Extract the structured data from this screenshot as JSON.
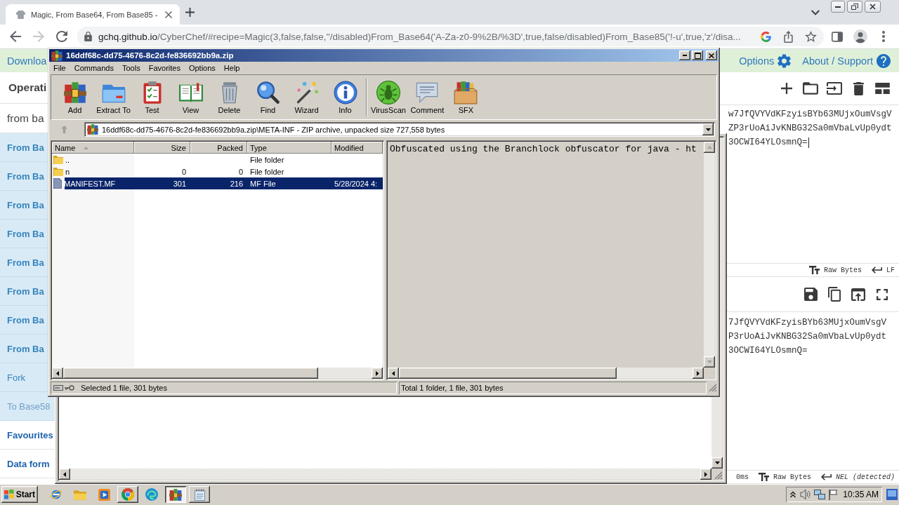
{
  "browser": {
    "tab": {
      "title": "Magic, From Base64, From Base85 -",
      "selected": true
    },
    "nav": [
      {
        "kind": "back",
        "disabled": false
      },
      {
        "kind": "forward",
        "disabled": true
      },
      {
        "kind": "reload",
        "disabled": false
      }
    ],
    "address": {
      "host": "gchq.github.io",
      "path": "/CyberChef/#recipe=Magic(3,false,false,''/disabled)From_Base64('A-Za-z0-9%2B/%3D',true,false/disabled)From_Base85('!-u',true,'z'/disa..."
    }
  },
  "cyberchef": {
    "banner": {
      "download": "Downloa",
      "options": "Options",
      "about": "About / Support"
    },
    "operations": {
      "title": "Operati",
      "search": "from ba",
      "items": [
        {
          "label": "From Ba",
          "kind": "match"
        },
        {
          "label": "From Ba",
          "kind": "match"
        },
        {
          "label": "From Ba",
          "kind": "match"
        },
        {
          "label": "From Ba",
          "kind": "match"
        },
        {
          "label": "From Ba",
          "kind": "match"
        },
        {
          "label": "From Ba",
          "kind": "match"
        },
        {
          "label": "From Ba",
          "kind": "match"
        },
        {
          "label": "From Ba",
          "kind": "match"
        },
        {
          "label": "Fork",
          "kind": "plain"
        },
        {
          "label": "To Base58",
          "kind": "faded"
        },
        {
          "label": "Favourites",
          "kind": "category"
        },
        {
          "label": "Data form",
          "kind": "category"
        }
      ]
    },
    "input": {
      "lines": [
        "w7JfQVYVdKFzyisBYb63MUjxOumVsgV",
        "ZP3rUoAiJvKNBG32Sa0mVbaLvUp0ydt",
        "3OCWI64YLOsmnQ="
      ],
      "format": "Raw Bytes",
      "eol": "LF"
    },
    "output": {
      "lines": [
        "7JfQVYVdKFzyisBYb63MUjxOumVsgV",
        "P3rUoAiJvKNBG32Sa0mVbaLvUp0ydt",
        "3OCWI64YLOsmnQ="
      ],
      "time": "0ms",
      "format": "Raw Bytes",
      "eol": "NEL (detected)"
    }
  },
  "winrar": {
    "title": "16ddf68c-dd75-4676-8c2d-fe836692bb9a.zip",
    "menu": [
      "File",
      "Commands",
      "Tools",
      "Favorites",
      "Options",
      "Help"
    ],
    "toolbar": [
      {
        "buttons": [
          {
            "label": "Add",
            "kind": "add"
          },
          {
            "label": "Extract To",
            "kind": "extract"
          },
          {
            "label": "Test",
            "kind": "test"
          },
          {
            "label": "View",
            "kind": "view"
          },
          {
            "label": "Delete",
            "kind": "delete"
          },
          {
            "label": "Find",
            "kind": "find"
          },
          {
            "label": "Wizard",
            "kind": "wizard"
          },
          {
            "label": "Info",
            "kind": "info"
          }
        ]
      },
      {
        "buttons": [
          {
            "label": "VirusScan",
            "kind": "virusscan"
          },
          {
            "label": "Comment",
            "kind": "comment"
          },
          {
            "label": "SFX",
            "kind": "sfx"
          }
        ]
      }
    ],
    "up_button": {
      "disabled": true
    },
    "path": "16ddf68c-dd75-4676-8c2d-fe836692bb9a.zip\\META-INF - ZIP archive, unpacked size 727,558 bytes",
    "columns": [
      {
        "label": "Name",
        "sorted": true
      },
      {
        "label": "Size",
        "sorted": false
      },
      {
        "label": "Packed",
        "sorted": false
      },
      {
        "label": "Type",
        "sorted": false
      },
      {
        "label": "Modified",
        "sorted": false
      }
    ],
    "rows": [
      {
        "kind": "folder",
        "name": "..",
        "type": "File folder",
        "selected": false
      },
      {
        "kind": "folder",
        "name": "n",
        "size": "0",
        "packed": "0",
        "type": "File folder",
        "selected": false
      },
      {
        "kind": "file",
        "name": "MANIFEST.MF",
        "size": "301",
        "packed": "216",
        "type": "MF File",
        "modified": "5/28/2024 4:",
        "selected": true
      }
    ],
    "preview": "Obfuscated using the Branchlock obfuscator for java - ht",
    "status": {
      "selection": "Selected 1 file, 301 bytes",
      "total": "Total 1 folder, 1 file, 301 bytes"
    }
  },
  "taskbar": {
    "start": "Start",
    "apps": [
      {
        "kind": "ie",
        "running": false,
        "selected": false
      },
      {
        "kind": "explorer",
        "running": false,
        "selected": false
      },
      {
        "kind": "media",
        "running": false,
        "selected": false
      },
      {
        "kind": "chrome",
        "running": true,
        "selected": false
      },
      {
        "kind": "edge",
        "running": false,
        "selected": false
      },
      {
        "kind": "winrar",
        "running": true,
        "selected": true
      },
      {
        "kind": "notepad",
        "running": true,
        "selected": false
      }
    ],
    "clock": "10:35 AM"
  }
}
